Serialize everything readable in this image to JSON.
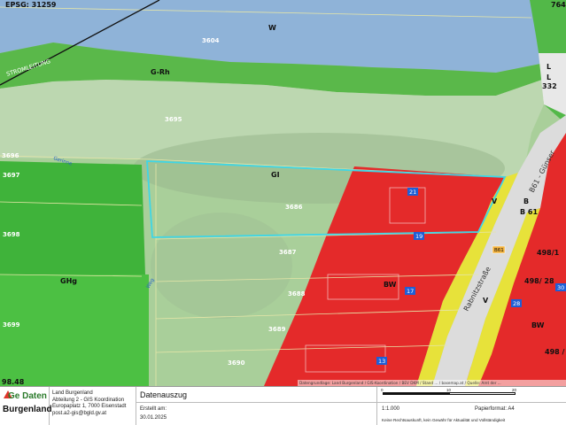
{
  "map": {
    "epsg": "EPSG: 31259",
    "top_right_code": "764",
    "zones": {
      "w": "W",
      "grh": "G-Rh",
      "gi": "GI",
      "ghg": "GHg",
      "bw1": "BW",
      "bw2": "BW",
      "v1": "V",
      "v2": "V",
      "l": "L",
      "l2": "L",
      "b": "B"
    },
    "road_labels": {
      "b61": "B 61",
      "b61_small": "B61",
      "gunsee": "B61 - Günser",
      "rabnitz": "Rabnitzstraße",
      "stromleitung": "STROMLEITUNG",
      "gerinne": "Gerinne",
      "weg": "Weg"
    },
    "parcels": {
      "p3604": "3604",
      "p3695": "3695",
      "p3696": "3696",
      "p3697": "3697",
      "p3698": "3698",
      "p3699": "3699",
      "p3686": "3686",
      "p3687": "3687",
      "p3688": "3688",
      "p3689": "3689",
      "p3690": "3690",
      "p332": "332",
      "p498_1": "498/1",
      "p498_28": "498/ 28",
      "p498": "498 /"
    },
    "house_numbers": {
      "h21": "21",
      "h19": "19",
      "h17": "17",
      "h13": "13",
      "h28": "28",
      "h30": "30"
    },
    "corner_left": "98.48",
    "attribution": "Datengrundlage: Land Burgenland / GIS-Koordination / BEV DKM / Stand ... / basemap.at / Quelle: Amt der ..."
  },
  "footer": {
    "logo_top": "Ge Daten",
    "logo_bottom": "Burgenland",
    "org_lines": [
      "Land Burgenland",
      "Abteilung 2 - GIS Koordination",
      "Europaplatz 1, 7000 Eisenstadt",
      "post.a2-gis@bgld.gv.at"
    ],
    "title": "Datenauszug",
    "created_label": "Erstellt am:",
    "created_date": "30.01.2025",
    "scale_ticks": [
      "0",
      "10",
      "20"
    ],
    "scale": "1:1.000",
    "paper_format": "Papierformat: A4",
    "disclaimer": "Keine Rechtsauskunft, kein Gewähr für Aktualität und Vollständigkeit"
  }
}
